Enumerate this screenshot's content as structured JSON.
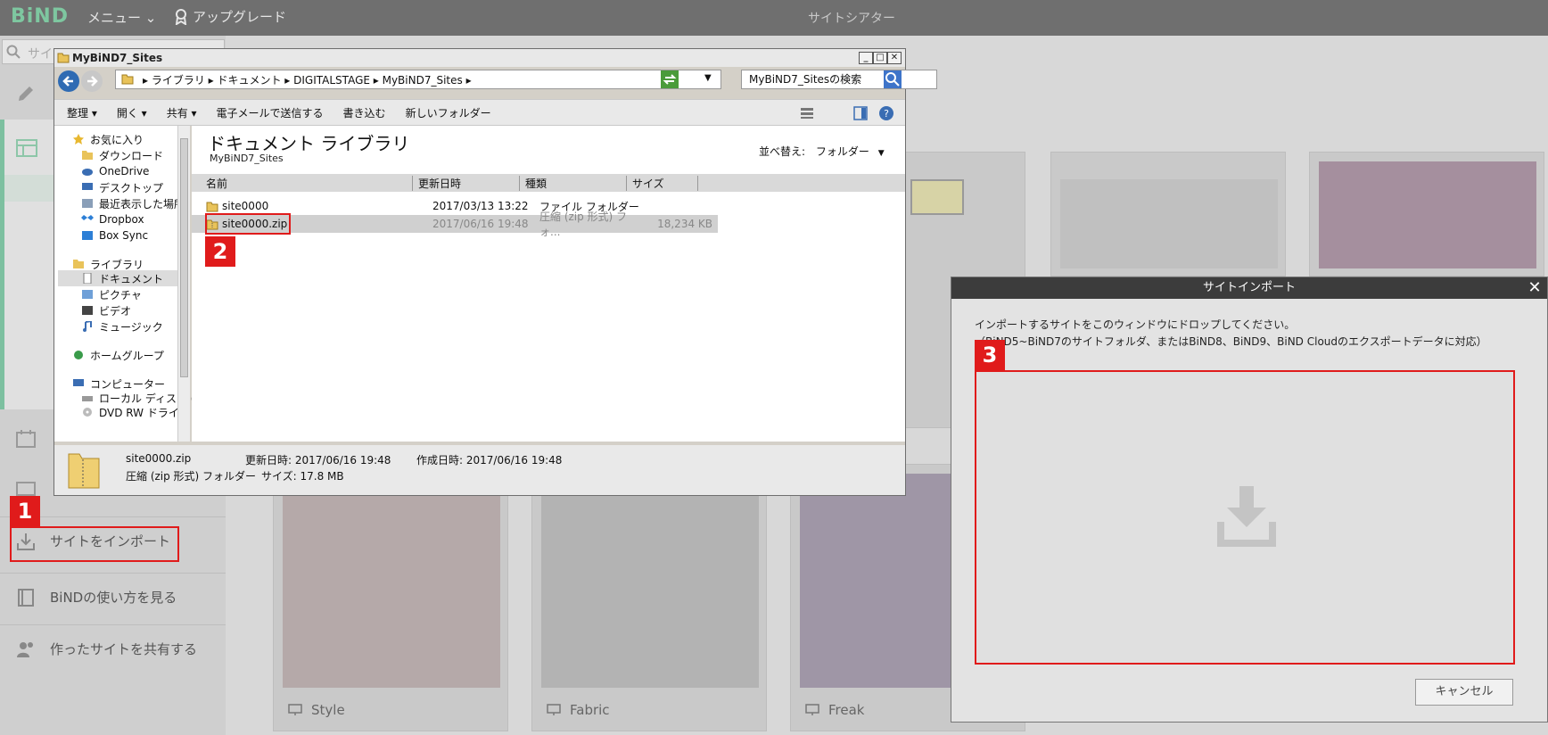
{
  "app": {
    "logo": "BiND",
    "menu_label": "メニュー",
    "upgrade_label": "アップグレード",
    "title": "サイトシアター"
  },
  "sidebar": {
    "search_placeholder": "サイ",
    "import_label": "サイトをインポート",
    "howto_label": "BiNDの使い方を見る",
    "share_label": "作ったサイトを共有する"
  },
  "cards": [
    {
      "label": "Style"
    },
    {
      "label": "Fabric"
    },
    {
      "label": "Freak"
    }
  ],
  "badges": [
    "1",
    "2",
    "3"
  ],
  "explorer": {
    "title": "MyBiND7_Sites",
    "breadcrumb": "▸ ライブラリ ▸ ドキュメント ▸ DIGITALSTAGE ▸ MyBiND7_Sites ▸",
    "search_value": "MyBiND7_Sitesの検索",
    "toolbar": [
      "整理 ▾",
      "開く ▾",
      "共有 ▾",
      "電子メールで送信する",
      "書き込む",
      "新しいフォルダー"
    ],
    "nav": {
      "favorites": "お気に入り",
      "fav_items": [
        "ダウンロード",
        "OneDrive",
        "デスクトップ",
        "最近表示した場所",
        "Dropbox",
        "Box Sync"
      ],
      "library": "ライブラリ",
      "lib_items": [
        "ドキュメント",
        "ピクチャ",
        "ビデオ",
        "ミュージック"
      ],
      "homegroup": "ホームグループ",
      "computer": "コンピューター",
      "comp_items": [
        "ローカル ディスク (",
        "DVD RW ドライブ"
      ]
    },
    "content_title": "ドキュメント ライブラリ",
    "content_subtitle": "MyBiND7_Sites",
    "sort_label": "並べ替え:",
    "sort_value": "フォルダー",
    "columns": [
      "名前",
      "更新日時",
      "種類",
      "サイズ"
    ],
    "files": [
      {
        "name": "site0000",
        "date": "2017/03/13 13:22",
        "type": "ファイル フォルダー",
        "size": ""
      },
      {
        "name": "site0000.zip",
        "date": "2017/06/16 19:48",
        "type": "圧縮 (zip 形式) フォ...",
        "size": "18,234 KB"
      }
    ],
    "status": {
      "name": "site0000.zip",
      "modified": "更新日時: 2017/06/16 19:48",
      "created": "作成日時: 2017/06/16 19:48",
      "kind": "圧縮 (zip 形式) フォルダー",
      "size": "サイズ: 17.8 MB"
    }
  },
  "dialog": {
    "title": "サイトインポート",
    "message1": "インポートするサイトをこのウィンドウにドロップしてください。",
    "message2": "（BiND5~BiND7のサイトフォルダ、またはBiND8、BiND9、BiND Cloudのエクスポートデータに対応）",
    "cancel_label": "キャンセル"
  },
  "colors": {
    "accent_red": "#e01b1b",
    "logo_green": "#7ec7a0"
  }
}
